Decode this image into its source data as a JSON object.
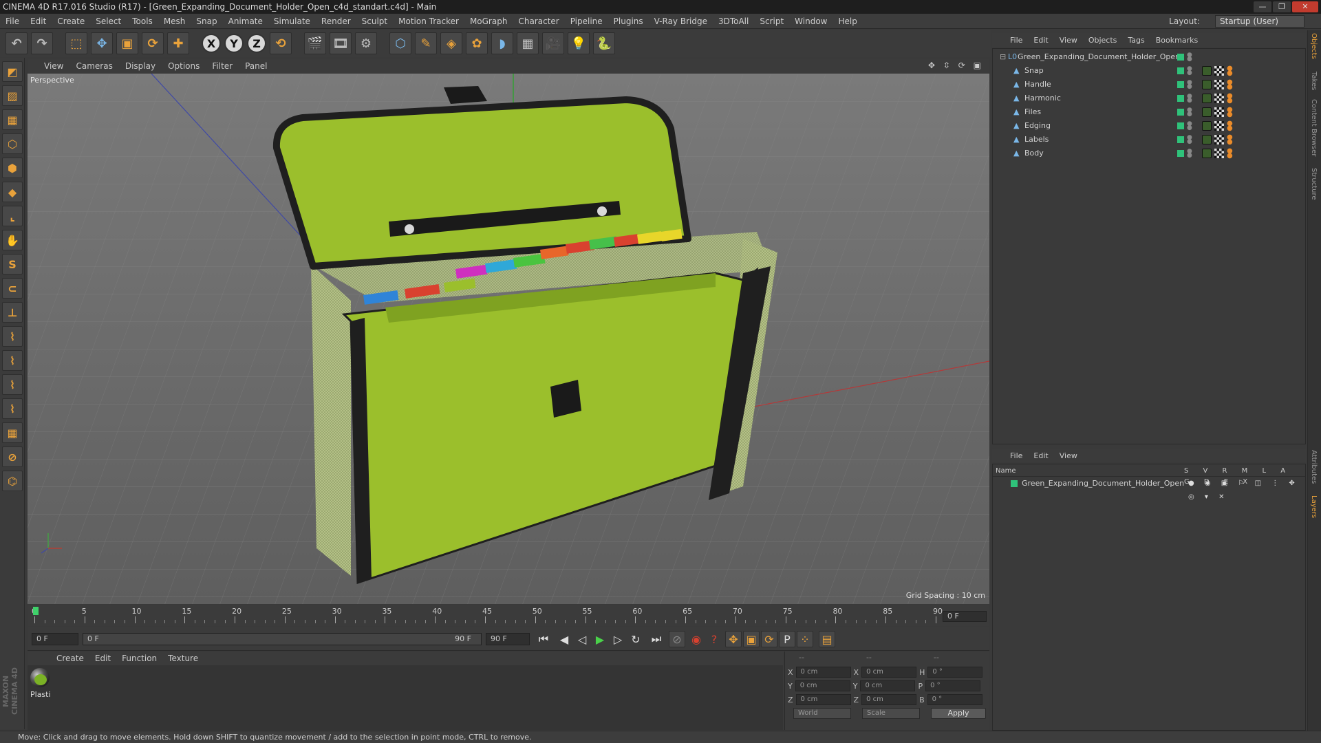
{
  "window": {
    "title": "CINEMA 4D R17.016 Studio (R17) - [Green_Expanding_Document_Holder_Open_c4d_standart.c4d] - Main",
    "buttons": [
      "—",
      "❐",
      "✕"
    ]
  },
  "menu": [
    "File",
    "Edit",
    "Create",
    "Select",
    "Tools",
    "Mesh",
    "Snap",
    "Animate",
    "Simulate",
    "Render",
    "Sculpt",
    "Motion Tracker",
    "MoGraph",
    "Character",
    "Pipeline",
    "Plugins",
    "V-Ray Bridge",
    "3DToAll",
    "Script",
    "Window",
    "Help"
  ],
  "layout": {
    "label": "Layout:",
    "value": "Startup (User)"
  },
  "toolbar": {
    "undo": "↶",
    "redo": "↷",
    "select": "⬚",
    "move": "✥",
    "scale": "▣",
    "rotate": "⟳",
    "add": "✚",
    "axis_x": "X",
    "axis_y": "Y",
    "axis_z": "Z",
    "coord": "⟲",
    "render1": "🎬",
    "render2": "🎞",
    "render3": "⚙",
    "cube": "⬡",
    "pen": "✎",
    "subd": "◈",
    "mograph": "✿",
    "deform": "◗",
    "floor": "▦",
    "camera": "🎥",
    "light": "💡",
    "python": "🐍"
  },
  "viewport": {
    "menu": [
      "View",
      "Cameras",
      "Display",
      "Options",
      "Filter",
      "Panel"
    ],
    "label": "Perspective",
    "grid_spacing": "Grid Spacing : 10 cm",
    "nav_icons": "✥ ⇳ ⟳ ▣"
  },
  "timeline": {
    "ticks": [
      "0",
      "5",
      "10",
      "15",
      "20",
      "25",
      "30",
      "35",
      "40",
      "45",
      "50",
      "55",
      "60",
      "65",
      "70",
      "75",
      "80",
      "85",
      "90"
    ],
    "current_frame": "0 F",
    "start_field": "0 F",
    "range_start": "0 F",
    "range_end": "90 F",
    "end_field": "90 F"
  },
  "transport": {
    "to_start": "⏮",
    "prev_key": "◀",
    "prev": "◁",
    "play": "▶",
    "next": "▷",
    "next_key": "↻",
    "to_end": "⏭"
  },
  "material": {
    "menu": [
      "Create",
      "Edit",
      "Function",
      "Texture"
    ],
    "items": [
      {
        "label": "Plasti"
      }
    ]
  },
  "coordinates": {
    "header": [
      "--",
      "--",
      "--"
    ],
    "rows": [
      {
        "a": "X",
        "av": "0 cm",
        "b": "X",
        "bv": "0 cm",
        "c": "H",
        "cv": "0 °"
      },
      {
        "a": "Y",
        "av": "0 cm",
        "b": "Y",
        "bv": "0 cm",
        "c": "P",
        "cv": "0 °"
      },
      {
        "a": "Z",
        "av": "0 cm",
        "b": "Z",
        "bv": "0 cm",
        "c": "B",
        "cv": "0 °"
      }
    ],
    "world": "World",
    "scale": "Scale",
    "apply": "Apply"
  },
  "objects": {
    "menu": [
      "File",
      "Edit",
      "View",
      "Objects",
      "Tags",
      "Bookmarks"
    ],
    "root": "Green_Expanding_Document_Holder_Open",
    "children": [
      "Snap",
      "Handle",
      "Harmonic",
      "Files",
      "Edging",
      "Labels",
      "Body"
    ]
  },
  "layers": {
    "menu": [
      "File",
      "Edit",
      "View"
    ],
    "header_name": "Name",
    "header_cols": "S V R M L A G D E X",
    "row_name": "Green_Expanding_Document_Holder_Open",
    "row_icons": "● ◉ ▣ ⚐ ◫ ⋮ ✥ ◎ ▾ ✕"
  },
  "right_tabs": [
    "Objects",
    "Takes",
    "Content Browser",
    "Structure",
    "Attributes",
    "Layers"
  ],
  "status": "Move: Click and drag to move elements. Hold down SHIFT to quantize movement / add to the selection in point mode, CTRL to remove.",
  "maxon": "MAXON CINEMA 4D",
  "colors": {
    "bag": "#9bbf2c",
    "bag_dark": "#7fa221",
    "edge": "#1f1f1f",
    "accent": "#e9a23b",
    "green_dot": "#2fc27a"
  }
}
